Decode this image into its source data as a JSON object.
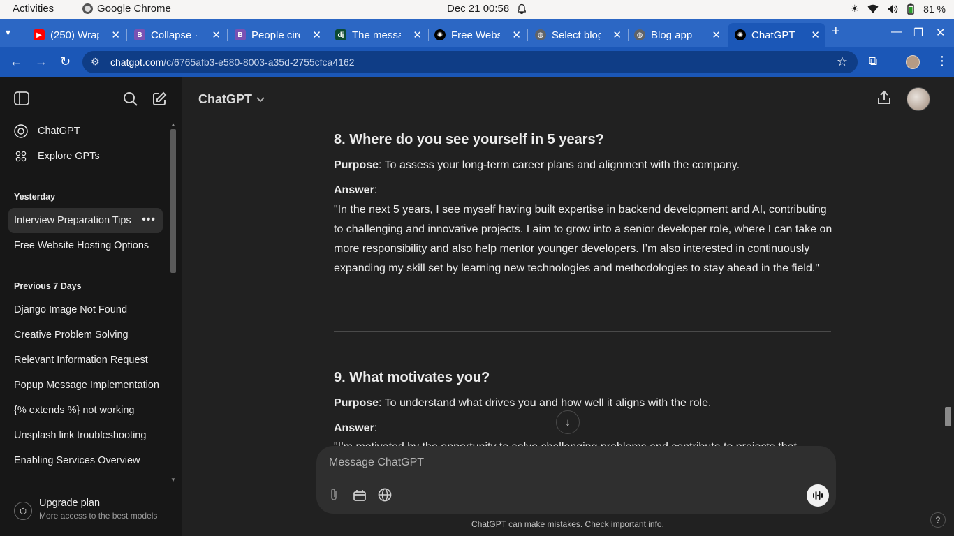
{
  "system": {
    "activities": "Activities",
    "app_name": "Google Chrome",
    "clock": "Dec 21  00:58",
    "battery": "81 %"
  },
  "tabs": [
    {
      "title": "(250) Wrap",
      "favicon": "youtube-icon",
      "color": "#ff0000"
    },
    {
      "title": "Collapse · B",
      "favicon": "bootstrap-icon",
      "color": "#7952b3"
    },
    {
      "title": "People circ",
      "favicon": "bootstrap-icon",
      "color": "#7952b3"
    },
    {
      "title": "The messa",
      "favicon": "django-icon",
      "color": "#0c4b33"
    },
    {
      "title": "Free Webs",
      "favicon": "openai-icon",
      "color": "#000000"
    },
    {
      "title": "Select blog",
      "favicon": "globe-icon",
      "color": "#5f6368"
    },
    {
      "title": "Blog app",
      "favicon": "globe-icon",
      "color": "#5f6368"
    },
    {
      "title": "ChatGPT",
      "favicon": "openai-icon",
      "color": "#000000"
    }
  ],
  "address": {
    "host": "chatgpt.com",
    "path": "/c/6765afb3-e580-8003-a35d-2755cfca4162"
  },
  "sidebar": {
    "top_items": [
      {
        "label": "ChatGPT",
        "icon": "openai-logo-icon"
      },
      {
        "label": "Explore GPTs",
        "icon": "grid-icon"
      }
    ],
    "sections": [
      {
        "heading": "Yesterday",
        "items": [
          "Interview Preparation Tips",
          "Free Website Hosting Options"
        ]
      },
      {
        "heading": "Previous 7 Days",
        "items": [
          "Django Image Not Found",
          "Creative Problem Solving",
          "Relevant Information Request",
          "Popup Message Implementation",
          "{% extends %} not working",
          "Unsplash link troubleshooting",
          "Enabling Services Overview"
        ]
      }
    ],
    "upgrade": {
      "title": "Upgrade plan",
      "subtitle": "More access to the best models"
    }
  },
  "main": {
    "model": "ChatGPT",
    "q8": {
      "heading": "8. Where do you see yourself in 5 years?",
      "purpose_label": "Purpose",
      "purpose_text": ": To assess your long-term career plans and alignment with the company.",
      "answer_label": "Answer",
      "answer_colon": ":",
      "answer_text": "\"In the next 5 years, I see myself having built expertise in backend development and AI, contributing to challenging and innovative projects. I aim to grow into a senior developer role, where I can take on more responsibility and also help mentor younger developers. I’m also interested in continuously expanding my skill set by learning new technologies and methodologies to stay ahead in the field.\""
    },
    "q9": {
      "heading": "9. What motivates you?",
      "purpose_label": "Purpose",
      "purpose_text": ": To understand what drives you and how well it aligns with the role.",
      "answer_label": "Answer",
      "answer_colon": ":",
      "answer_partial": "\"I’m motivated by the opportunity to solve challenging problems and contribute to projects that"
    },
    "composer_placeholder": "Message ChatGPT",
    "disclaimer": "ChatGPT can make mistakes. Check important info.",
    "help": "?"
  },
  "colors": {
    "tabstrip": "#2c67c4",
    "toolbar": "#1b57b7",
    "sidebar_bg": "#171717",
    "main_bg": "#212121",
    "composer_bg": "#2f2f2f"
  }
}
